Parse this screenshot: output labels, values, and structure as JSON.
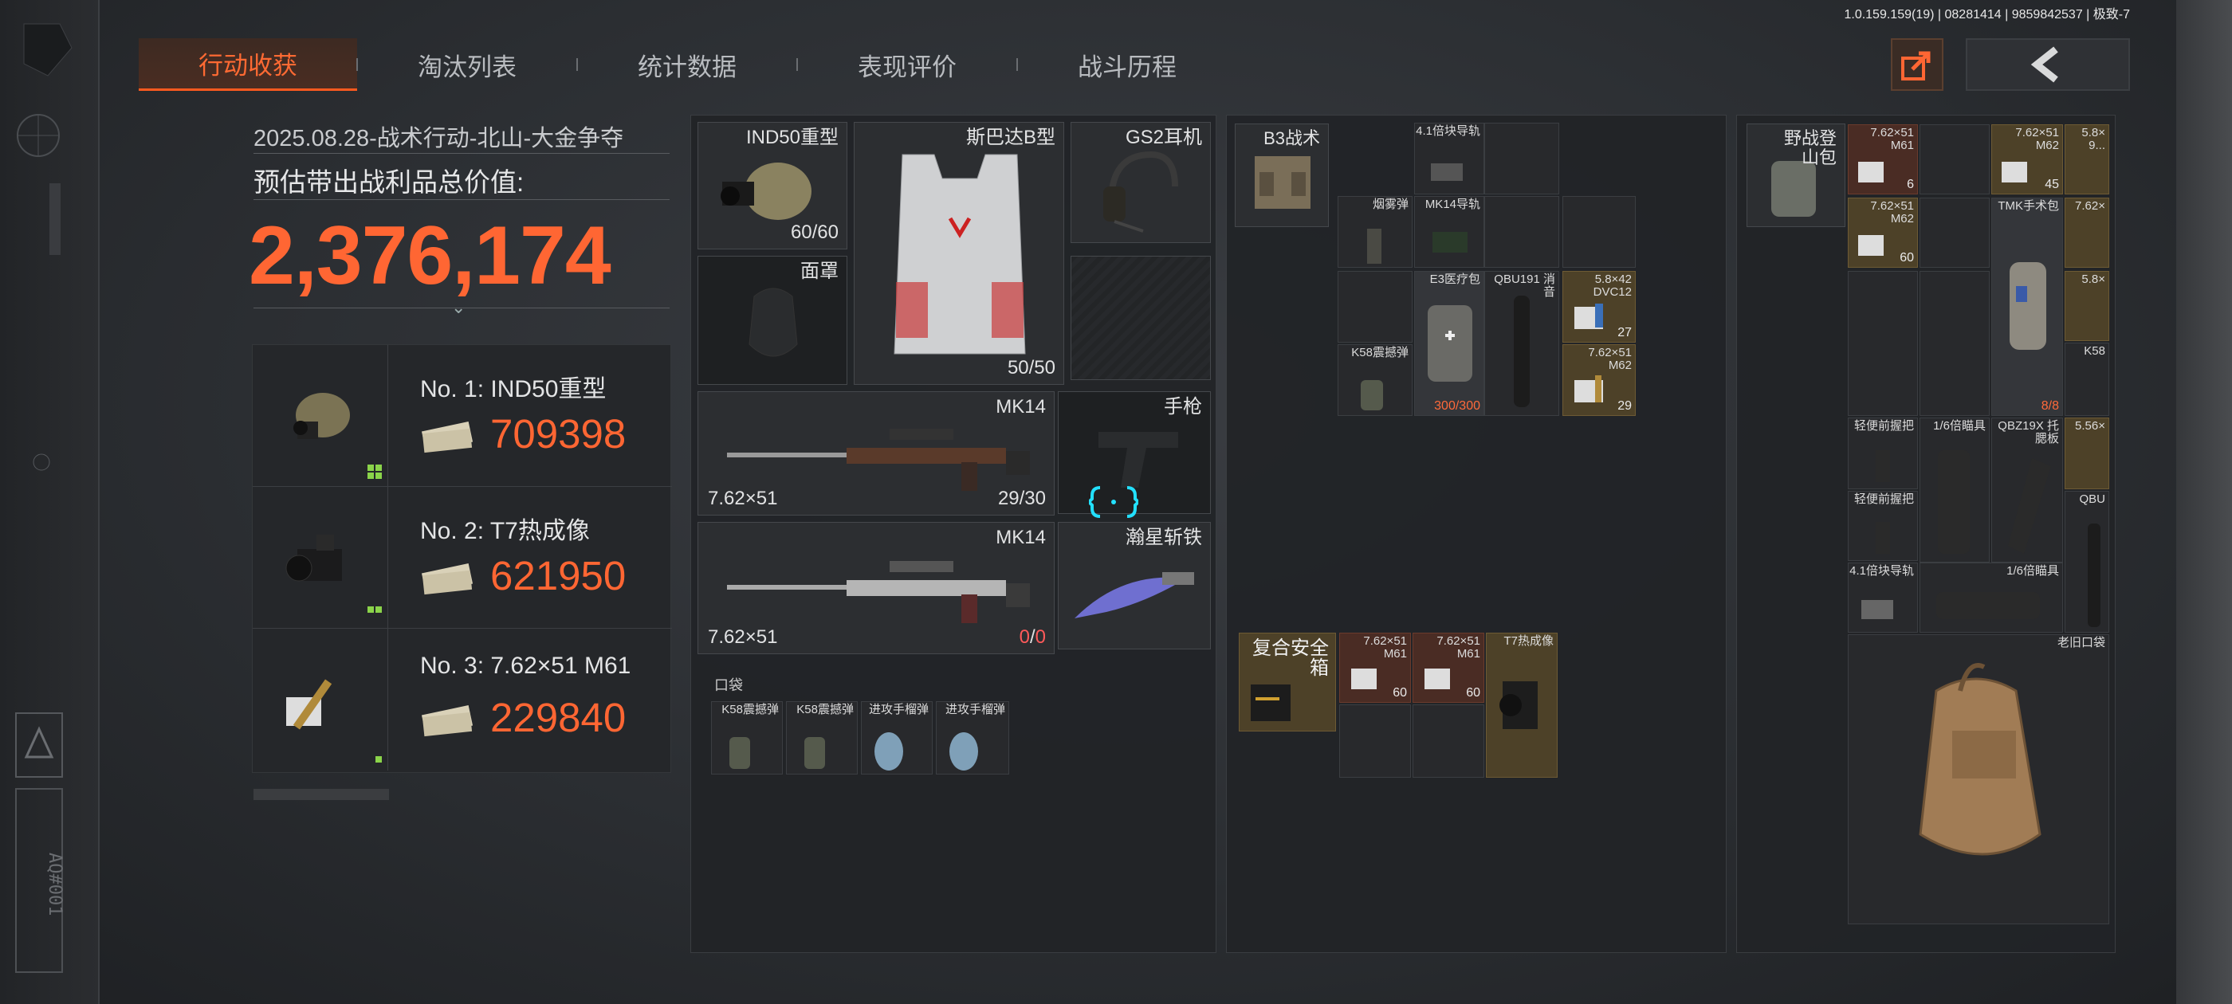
{
  "version": "1.0.159.159(19) | 08281414 | 9859842537 | 极致-7",
  "nav": {
    "tabs": [
      {
        "label": "行动收获",
        "active": true
      },
      {
        "label": "淘汰列表",
        "active": false
      },
      {
        "label": "统计数据",
        "active": false
      },
      {
        "label": "表现评价",
        "active": false
      },
      {
        "label": "战斗历程",
        "active": false
      }
    ]
  },
  "summary": {
    "date_line": "2025.08.28-战术行动-北山-大金争夺",
    "total_label": "预估带出战利品总价值:",
    "total_value": "2,376,174"
  },
  "top_items": [
    {
      "name": "No. 1: IND50重型",
      "value": "709398"
    },
    {
      "name": "No. 2: T7热成像",
      "value": "621950"
    },
    {
      "name": "No. 3: 7.62×51 M61",
      "value": "229840"
    }
  ],
  "equipment": {
    "helmet": {
      "label": "IND50重型",
      "durability": "60/60"
    },
    "armor": {
      "label": "斯巴达B型",
      "durability": "50/50"
    },
    "headset": {
      "label": "GS2耳机"
    },
    "mask": {
      "label": "面罩"
    },
    "primary1": {
      "label": "MK14",
      "caliber": "7.62×51",
      "ammo": "29/30"
    },
    "pistol": {
      "label": "手枪"
    },
    "primary2": {
      "label": "MK14",
      "caliber": "7.62×51",
      "ammo_current": "0",
      "ammo_max": "0"
    },
    "melee": {
      "label": "瀚星斩铁"
    },
    "pocket_label": "口袋",
    "pockets": [
      "K58震撼弹",
      "K58震撼弹",
      "进攻手榴弹",
      "进攻手榴弹"
    ]
  },
  "rig": {
    "label": "B3战术",
    "items": {
      "rail": "4.1倍块导轨",
      "smoke": "烟雾弹",
      "mk14rail": "MK14导轨",
      "medkit": {
        "label": "E3医疗包",
        "count": "300/300"
      },
      "suppressor": "QBU191 消音",
      "ammo1": {
        "label": "5.8×42 DVC12",
        "count": "27"
      },
      "k58": "K58震撼弹",
      "ammo2": {
        "label": "7.62×51 M62",
        "count": "29"
      }
    },
    "safe_box": {
      "label": "复合安全箱",
      "items": [
        {
          "label": "7.62×51 M61",
          "count": "60"
        },
        {
          "label": "7.62×51 M61",
          "count": "60"
        },
        {
          "label": "T7热成像"
        }
      ]
    }
  },
  "backpack": {
    "label": "野战登山包",
    "items": {
      "a1": {
        "label": "7.62×51 M61",
        "count": "6"
      },
      "a2": {
        "label": "7.62×51 M62",
        "count": "45"
      },
      "a3": {
        "label": "5.8× 9..."
      },
      "a4": {
        "label": "7.62×51 M62",
        "count": "60"
      },
      "tmk": {
        "label": "TMK手术包",
        "count": "8/8"
      },
      "a5": {
        "label": "7.62×"
      },
      "a6": {
        "label": "5.8×"
      },
      "k58": {
        "label": "K58"
      },
      "grip1": "轻便前握把",
      "scope1": "1/6倍瞄具",
      "qbz": "QBZ19X 托腮板",
      "a7": {
        "label": "5.56×"
      },
      "grip2": "轻便前握把",
      "qbu": "QBU",
      "rail": "4.1倍块导轨",
      "scope2": "1/6倍瞄具",
      "oldbag": "老旧口袋"
    }
  },
  "colors": {
    "accent": "#ff6633",
    "gold_slot": "#4d4128",
    "red_slot": "#4a2c24"
  }
}
